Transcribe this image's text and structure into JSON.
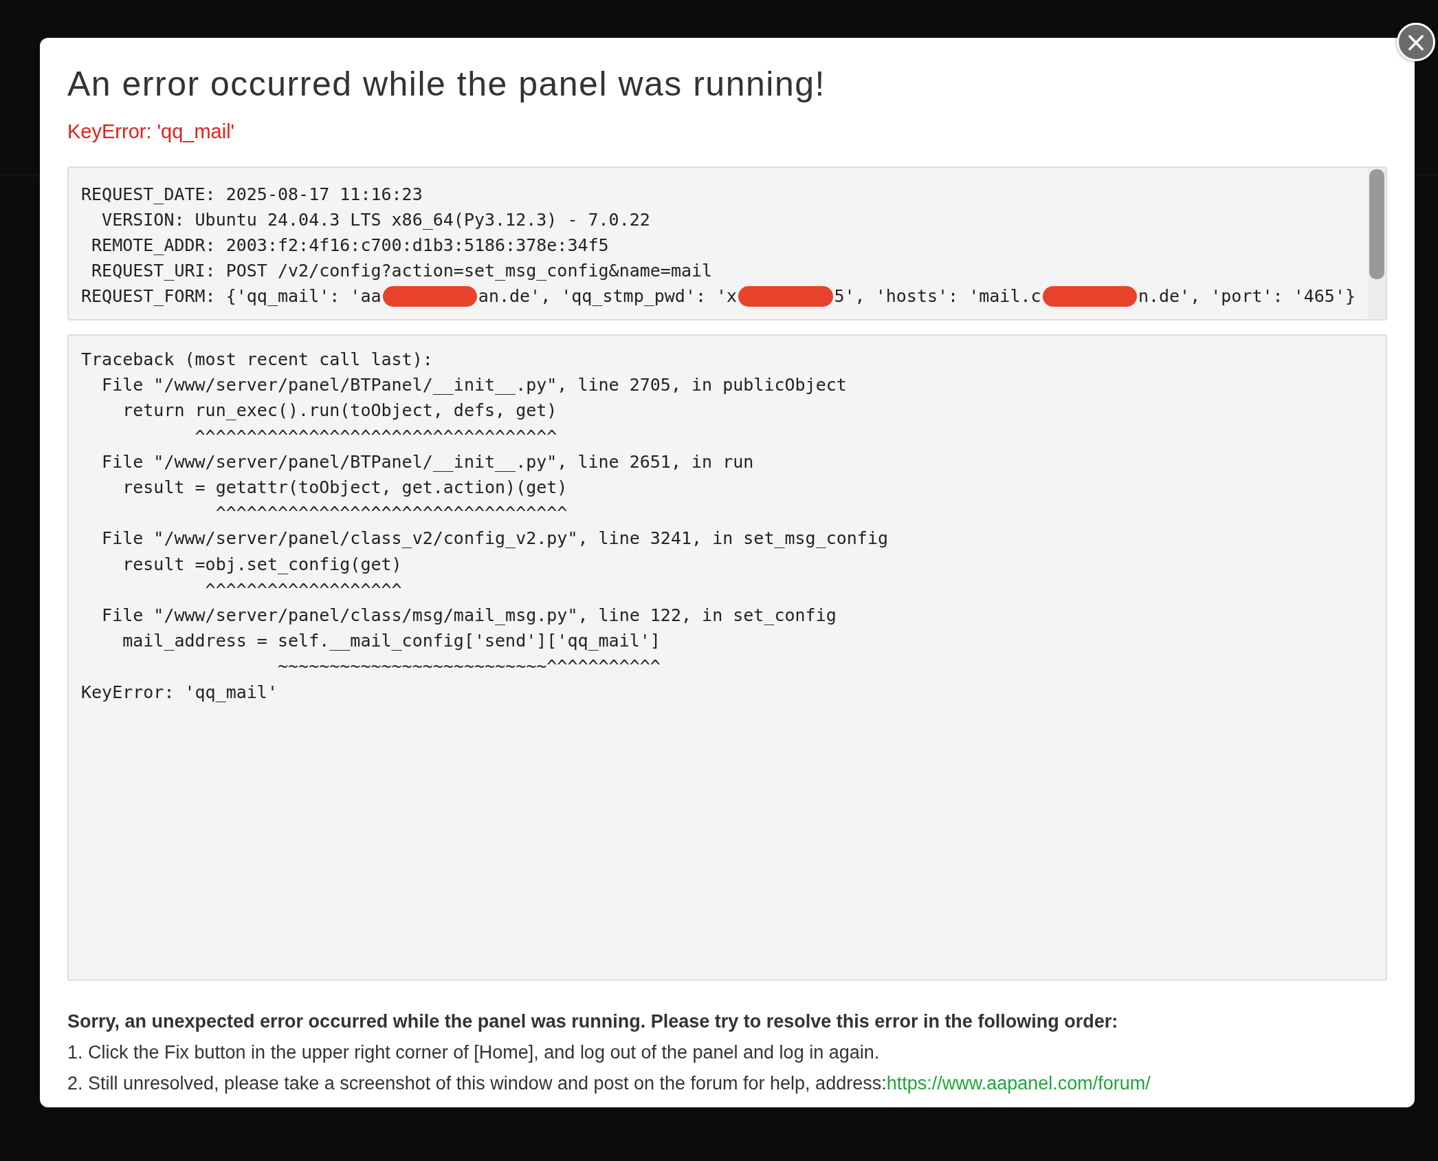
{
  "dialog": {
    "title": "An error occurred while the panel was running!",
    "error": "KeyError: 'qq_mail'",
    "request_lines": [
      [
        {
          "kind": "text",
          "text": "REQUEST_DATE: 2025-08-17 11:16:23"
        }
      ],
      [
        {
          "kind": "text",
          "text": "  VERSION: Ubuntu 24.04.3 LTS x86_64(Py3.12.3) - 7.0.22"
        }
      ],
      [
        {
          "kind": "text",
          "text": " REMOTE_ADDR: 2003:f2:4f16:c700:d1b3:5186:378e:34f5"
        }
      ],
      [
        {
          "kind": "text",
          "text": " REQUEST_URI: POST /v2/config?action=set_msg_config&name=mail"
        }
      ],
      [
        {
          "kind": "text",
          "text": "REQUEST_FORM: {'qq_mail': 'aa"
        },
        {
          "kind": "redaction"
        },
        {
          "kind": "text",
          "text": "an.de', 'qq_stmp_pwd': 'x"
        },
        {
          "kind": "redaction"
        },
        {
          "kind": "text",
          "text": "5', 'hosts': 'mail.c"
        },
        {
          "kind": "redaction"
        },
        {
          "kind": "text",
          "text": "n.de', 'port': '465'}"
        }
      ]
    ],
    "traceback": "Traceback (most recent call last):\n  File \"/www/server/panel/BTPanel/__init__.py\", line 2705, in publicObject\n    return run_exec().run(toObject, defs, get)\n           ^^^^^^^^^^^^^^^^^^^^^^^^^^^^^^^^^^^\n  File \"/www/server/panel/BTPanel/__init__.py\", line 2651, in run\n    result = getattr(toObject, get.action)(get)\n             ^^^^^^^^^^^^^^^^^^^^^^^^^^^^^^^^^^\n  File \"/www/server/panel/class_v2/config_v2.py\", line 3241, in set_msg_config\n    result =obj.set_config(get)\n            ^^^^^^^^^^^^^^^^^^^\n  File \"/www/server/panel/class/msg/mail_msg.py\", line 122, in set_config\n    mail_address = self.__mail_config['send']['qq_mail']\n                   ~~~~~~~~~~~~~~~~~~~~~~~~~~^^^^^^^^^^^\nKeyError: 'qq_mail'",
    "help_title": "Sorry, an unexpected error occurred while the panel was running. Please try to resolve this error in the following order:",
    "help_steps": [
      {
        "text": "1. Click the Fix button in the upper right corner of [Home], and log out of the panel and log in again."
      },
      {
        "text": "2. Still unresolved, please take a screenshot of this window and post on the forum for help, address:",
        "link": "https://www.aapanel.com/forum/"
      }
    ],
    "close": "×"
  }
}
